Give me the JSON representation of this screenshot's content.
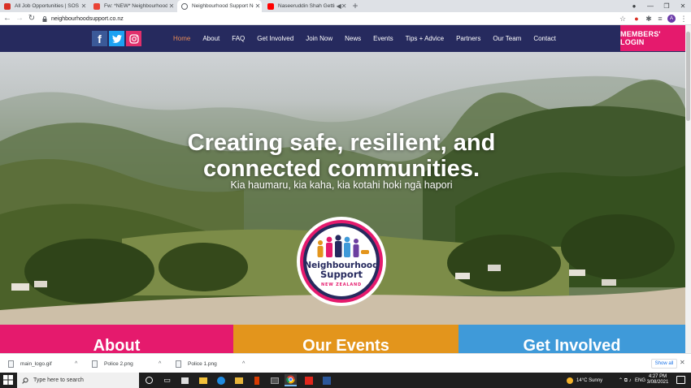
{
  "browser": {
    "tabs": [
      {
        "title": "All Job Opportunities | SOS New...",
        "favicon_color": "#d93025",
        "active": false
      },
      {
        "title": "Fw: *NEW* Neighbourhood Supp...",
        "favicon_color": "#ea4335",
        "active": false
      },
      {
        "title": "Neighbourhood Support New Zea...",
        "favicon_color": "#5f6368",
        "active": true
      },
      {
        "title": "Naseeruddin Shah Getting A...",
        "favicon_color": "#ff0000",
        "active": false
      }
    ],
    "new_tab_symbol": "+",
    "url": "neighbourhoodsupport.co.nz",
    "profile_initial": "A"
  },
  "site": {
    "social": {
      "facebook": "f"
    },
    "nav": [
      "Home",
      "About",
      "FAQ",
      "Get Involved",
      "Join Now",
      "News",
      "Events",
      "Tips + Advice",
      "Partners",
      "Our Team",
      "Contact"
    ],
    "members_login": "MEMBERS' LOGIN",
    "hero": {
      "title_line1": "Creating safe, resilient, and",
      "title_line2": "connected communities.",
      "subtitle": "Kia haumaru, kia kaha, kia kotahi hoki ngā hapori"
    },
    "logo": {
      "line1": "Neighbourhood",
      "line2": "Support",
      "line3": "NEW ZEALAND"
    },
    "panels": [
      {
        "label": "About",
        "color": "#e51a6d"
      },
      {
        "label": "Our Events",
        "color": "#e3951c"
      },
      {
        "label": "Get Involved",
        "color": "#3f9ad9"
      }
    ],
    "colors": {
      "header": "#262a5e",
      "accent_active": "#e98c57",
      "members": "#e51a6d"
    }
  },
  "downloads": {
    "items": [
      "main_logo.gif",
      "Police 2.png",
      "Police 1.png"
    ],
    "show_all": "Show all"
  },
  "taskbar": {
    "search_placeholder": "Type here to search",
    "weather": "14°C  Sunny",
    "language": "ENG",
    "time": "4:27 PM",
    "date": "3/08/2021"
  }
}
